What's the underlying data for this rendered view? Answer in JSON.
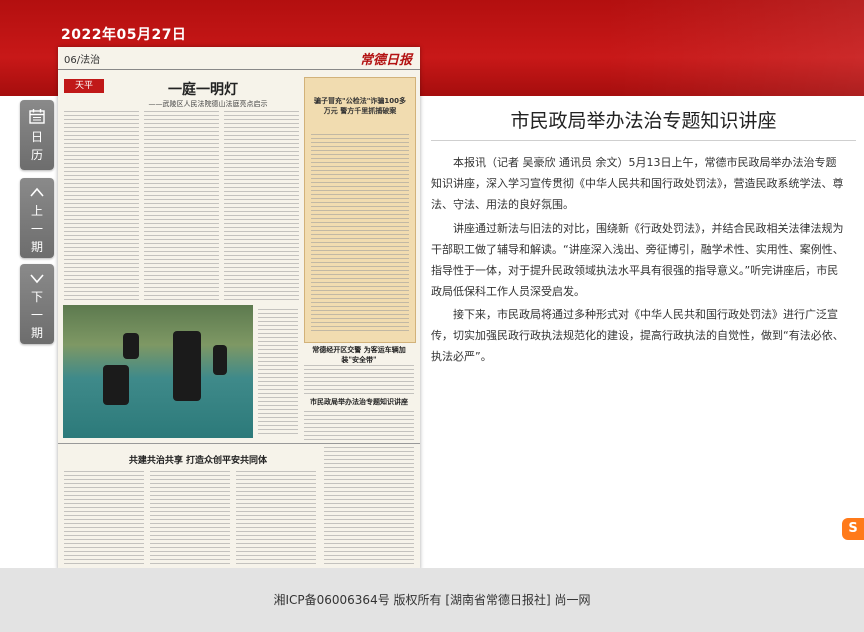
{
  "header": {
    "date": "2022年05月27日"
  },
  "sidebar": {
    "calendar_label": "日历",
    "prev_label": "上一期",
    "next_label": "下一期"
  },
  "newspaper_page": {
    "page_label": "06/法治",
    "masthead": "常德日报",
    "section_tag": "天平",
    "headline": "一庭一明灯",
    "subheadline": "——武陵区人民法院德山法庭亮点启示",
    "box_headline": "骗子冒充\"公检法\"诈骗100多万元 警方千里抓捕破案",
    "article2_headline": "常德经开区交警 为客运车辆加装\"安全带\"",
    "article3_headline": "市民政局举办法治专题知识讲座",
    "bottom_headline": "共建共治共享 打造众创平安共同体"
  },
  "article": {
    "title": "市民政局举办法治专题知识讲座",
    "paragraphs": [
      "本报讯（记者 吴豪欣 通讯员 余文）5月13日上午，常德市民政局举办法治专题知识讲座，深入学习宣传贯彻《中华人民共和国行政处罚法》，营造民政系统学法、尊法、守法、用法的良好氛围。",
      "讲座通过新法与旧法的对比，围绕新《行政处罚法》，并结合民政相关法律法规为干部职工做了辅导和解读。“讲座深入浅出、旁征博引，融学术性、实用性、案例性、指导性于一体，对于提升民政领域执法水平具有很强的指导意义。”听完讲座后，市民政局低保科工作人员深受启发。",
      "接下来，市民政局将通过多种形式对《中华人民共和国行政处罚法》进行广泛宣传，切实加强民政行政执法规范化的建设，提高行政执法的自觉性，做到“有法必依、执法必严”。"
    ]
  },
  "footer": {
    "text": "湘ICP备06006364号 版权所有 [湖南省常德日报社] 尚一网"
  },
  "icons": {
    "calendar": "calendar-icon",
    "prev": "chevron-up-icon",
    "next": "chevron-down-icon"
  },
  "colors": {
    "banner": "#c81818",
    "sidebar_button": "#7a7a7a",
    "accent": "#b31212"
  }
}
